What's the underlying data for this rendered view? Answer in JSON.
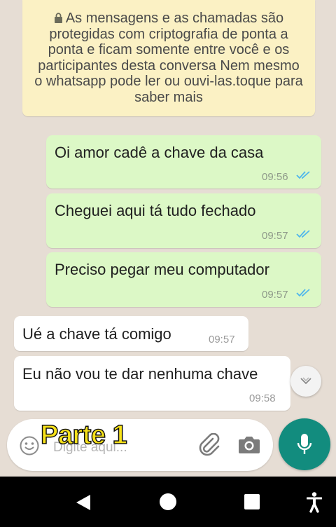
{
  "encryption_notice": "As mensagens e as chamadas são protegidas com criptografia de ponta a ponta e ficam somente entre você e os participantes desta conversa Nem mesmo o whatsapp pode ler ou ouvi-las.toque para saber mais",
  "messages": [
    {
      "direction": "outgoing",
      "text": "Oi amor cadê a chave da casa",
      "time": "09:56",
      "status": "read"
    },
    {
      "direction": "outgoing",
      "text": "Cheguei aqui tá tudo fechado",
      "time": "09:57",
      "status": "read"
    },
    {
      "direction": "outgoing",
      "text": "Preciso pegar meu computador",
      "time": "09:57",
      "status": "read"
    },
    {
      "direction": "incoming",
      "text": "Ué a chave tá comigo",
      "time": "09:57"
    },
    {
      "direction": "incoming",
      "text": "Eu não vou te dar nenhuma chave",
      "time": "09:58"
    }
  ],
  "composer": {
    "placeholder": "Digite aqui...",
    "icons": [
      "emoji-icon",
      "paperclip-icon",
      "camera-icon",
      "microphone-icon"
    ]
  },
  "overlay_caption": "Parte 1",
  "colors": {
    "outgoing_bubble": "#dcf8c6",
    "incoming_bubble": "#ffffff",
    "encryption_banner": "#fbf1c4",
    "read_ticks": "#4fb6ec",
    "mic_button": "#128c7e",
    "chat_background": "#e6ddd4",
    "caption": "#f7e219"
  },
  "navigation": [
    "back-icon",
    "home-icon",
    "recents-icon",
    "accessibility-icon"
  ]
}
